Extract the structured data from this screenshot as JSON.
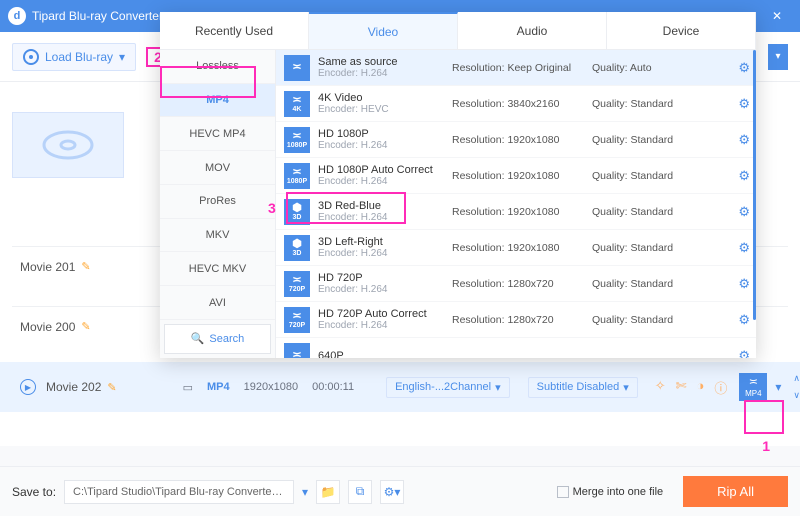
{
  "titlebar": {
    "app": "Tipard Blu-ray Converter",
    "logo": "d"
  },
  "toolbar": {
    "load": "Load Blu-ray"
  },
  "annot": {
    "n1": "1",
    "n2": "2",
    "n3": "3"
  },
  "movies": {
    "m1": "Movie 201",
    "m2": "Movie 200",
    "m3": "Movie 202"
  },
  "track": {
    "format": "MP4",
    "res": "1920x1080",
    "dur": "00:00:11",
    "audio": "English-...2Channel",
    "subtitle": "Subtitle Disabled",
    "outlabel": "MP4"
  },
  "footer": {
    "saveto": "Save to:",
    "path": "C:\\Tipard Studio\\Tipard Blu-ray Converter\\Ripper",
    "merge": "Merge into one file",
    "rip": "Rip All"
  },
  "popup": {
    "tabs": {
      "recent": "Recently Used",
      "video": "Video",
      "audio": "Audio",
      "device": "Device"
    },
    "sidebar": [
      "Lossless",
      "MP4",
      "HEVC MP4",
      "MOV",
      "ProRes",
      "MKV",
      "HEVC MKV",
      "AVI"
    ],
    "search": "Search",
    "formats": [
      {
        "icon": "≍",
        "sub": "",
        "name": "Same as source",
        "enc": "Encoder: H.264",
        "res": "Resolution: Keep Original",
        "qual": "Quality: Auto"
      },
      {
        "icon": "≍",
        "sub": "4K",
        "name": "4K Video",
        "enc": "Encoder: HEVC",
        "res": "Resolution: 3840x2160",
        "qual": "Quality: Standard"
      },
      {
        "icon": "≍",
        "sub": "1080P",
        "name": "HD 1080P",
        "enc": "Encoder: H.264",
        "res": "Resolution: 1920x1080",
        "qual": "Quality: Standard"
      },
      {
        "icon": "≍",
        "sub": "1080P",
        "name": "HD 1080P Auto Correct",
        "enc": "Encoder: H.264",
        "res": "Resolution: 1920x1080",
        "qual": "Quality: Standard"
      },
      {
        "icon": "⬢",
        "sub": "3D",
        "name": "3D Red-Blue",
        "enc": "Encoder: H.264",
        "res": "Resolution: 1920x1080",
        "qual": "Quality: Standard"
      },
      {
        "icon": "⬢",
        "sub": "3D",
        "name": "3D Left-Right",
        "enc": "Encoder: H.264",
        "res": "Resolution: 1920x1080",
        "qual": "Quality: Standard"
      },
      {
        "icon": "≍",
        "sub": "720P",
        "name": "HD 720P",
        "enc": "Encoder: H.264",
        "res": "Resolution: 1280x720",
        "qual": "Quality: Standard"
      },
      {
        "icon": "≍",
        "sub": "720P",
        "name": "HD 720P Auto Correct",
        "enc": "Encoder: H.264",
        "res": "Resolution: 1280x720",
        "qual": "Quality: Standard"
      },
      {
        "icon": "≍",
        "sub": "",
        "name": "640P",
        "enc": "",
        "res": "",
        "qual": ""
      }
    ]
  }
}
